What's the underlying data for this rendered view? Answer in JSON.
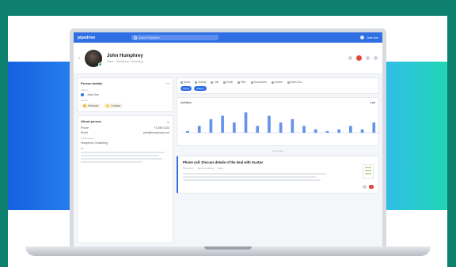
{
  "colors": {
    "accent": "#2f6fe4",
    "page_bg": "#0e8070",
    "danger": "#e04a3b",
    "online": "#3bb36b"
  },
  "topbar": {
    "brand": "pipedrive",
    "search_placeholder": "Search Pipedrive",
    "user": "Jane Doe"
  },
  "profile": {
    "name": "John Humphrey",
    "subtitle": "Sales · Humphrey Consulting"
  },
  "left": {
    "details_card": {
      "title": "Person details",
      "owner_label": "Owner",
      "owner_value": "Jane Doe",
      "labels_label": "Labels",
      "tags": [
        {
          "label": "Hot lead",
          "color": "#f4b740"
        },
        {
          "label": "Contact",
          "color": "#f7d64a"
        }
      ]
    },
    "about_card": {
      "title": "About person",
      "rows": [
        {
          "k": "Phone",
          "v": "+1 555 0123"
        },
        {
          "k": "Email",
          "v": "john@humphrey.com"
        }
      ],
      "org_label": "Organization",
      "org_value": "Humphrey Consulting",
      "note_label": "Bio"
    }
  },
  "right": {
    "tabs": [
      "Notes",
      "Activity",
      "Call",
      "Email",
      "Files",
      "Documents",
      "Invoice",
      "Sales Doc"
    ],
    "chips": [
      "Focus",
      "History"
    ],
    "chart": {
      "title": "Activities",
      "link": "Last"
    },
    "chart_data": {
      "type": "bar",
      "values": [
        0.5,
        2,
        4,
        5,
        3,
        6,
        2,
        5,
        3,
        4,
        2,
        1,
        0.5,
        1,
        2,
        1,
        3
      ]
    },
    "divider": "Upcoming",
    "activity": {
      "title": "Phone call: Discuss details of the deal with Gustav",
      "meta": [
        "Tomorrow",
        "John Humphrey",
        "Deal"
      ]
    }
  }
}
